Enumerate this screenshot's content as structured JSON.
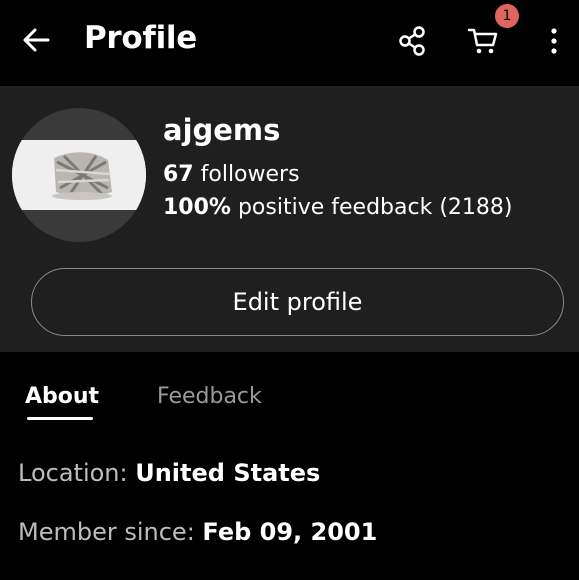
{
  "header": {
    "title": "Profile",
    "cart_badge": "1",
    "icons": [
      "back-arrow-icon",
      "share-icon",
      "cart-icon",
      "more-vert-icon"
    ]
  },
  "profile": {
    "username": "ajgems",
    "followers_count": "67",
    "followers_label": "followers",
    "feedback_percent": "100%",
    "feedback_label": "positive feedback",
    "feedback_count": "(2188)",
    "edit_button": "Edit profile"
  },
  "tabs": [
    {
      "label": "About",
      "selected": true
    },
    {
      "label": "Feedback",
      "selected": false
    }
  ],
  "about": {
    "location_label": "Location:",
    "location_value": "United States",
    "member_since_label": "Member since:",
    "member_since_value": "Feb 09, 2001"
  },
  "colors": {
    "background": "#000000",
    "card": "#1f1f1f",
    "badge": "#e0655d",
    "muted_text": "#9a9a9a"
  }
}
